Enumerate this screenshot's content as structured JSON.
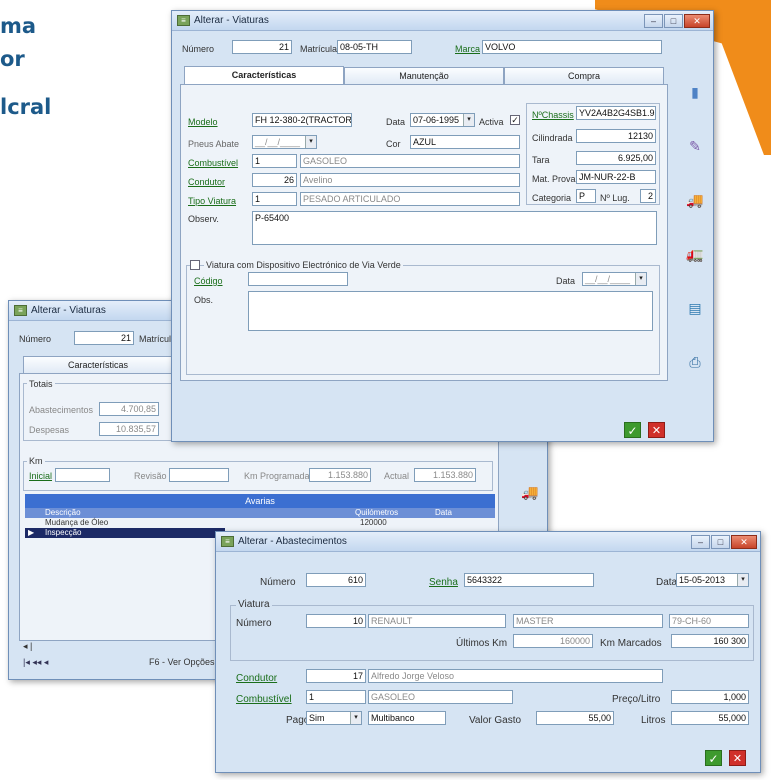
{
  "brand": {
    "line1": "ma",
    "line2": "or",
    "line3": "lcral"
  },
  "w1": {
    "title": "Alterar - Viaturas",
    "numero_label": "Número",
    "numero": "21",
    "matricula_label": "Matrícula",
    "matricula": "08-05-TH",
    "marca_label": "Marca",
    "marca": "VOLVO",
    "tabs": [
      "Características",
      "Manutenção",
      "Compra"
    ],
    "modelo_label": "Modelo",
    "modelo": "FH 12-380-2(TRACTOR)",
    "data_label": "Data",
    "data": "07-06-1995",
    "activa_label": "Activa",
    "activa_check": "✓",
    "pneus_label": "Pneus Abate",
    "pneus_val": "__/__/____",
    "cor_label": "Cor",
    "cor": "AZUL",
    "combustivel_label": "Combustível",
    "combustivel_num": "1",
    "combustivel": "GASOLEO",
    "condutor_label": "Condutor",
    "condutor_num": "26",
    "condutor": "Avelino",
    "tipo_label": "Tipo Viatura",
    "tipo_num": "1",
    "tipo": "PESADO ARTICULADO",
    "obs_label": "Observ.",
    "obs": "P-65400",
    "nchassis_label": "NºChassis",
    "nchassis": "YV2A4B2G4SB1.95",
    "cilindrada_label": "Cilindrada",
    "cilindrada": "12130",
    "tara_label": "Tara",
    "tara": "6.925,00",
    "matprova_label": "Mat. Prova",
    "matprova": "JM-NUR-22-B",
    "categoria_label": "Categoria",
    "categoria": "P",
    "nlug_label": "Nº Lug.",
    "nlug": "2",
    "disp_label": "Viatura com Dispositivo Electrónico de Via Verde",
    "codigo_label": "Código",
    "date_label": "Data",
    "date_val": "__/__/____",
    "obs2_label": "Obs."
  },
  "w2": {
    "title": "Alterar - Viaturas",
    "numero_label": "Número",
    "numero": "21",
    "matricula_label": "Matrícula",
    "tab": "Características",
    "totais_label": "Totais",
    "abast_label": "Abastecimentos",
    "abast": "4.700,85",
    "despesas_label": "Despesas",
    "despesas": "10.835,57",
    "km_label": "Km",
    "inicial_label": "Inicial",
    "revisao_label": "Revisão",
    "kmprog_label": "Km Programada",
    "kmprog": "1.153.880",
    "actual_label": "Actual",
    "actual": "1.153.880",
    "avarias_label": "Avarias",
    "col_desc": "Descrição",
    "col_kms": "Quilómetros",
    "col_data": "Data",
    "rows": [
      {
        "desc": "Mudança de Óleo",
        "kms": "120000"
      },
      {
        "desc": "Inspecção",
        "kms": ""
      }
    ],
    "status": "F6 - Ver Opções F"
  },
  "w3": {
    "title": "Alterar - Abastecimentos",
    "numero_label": "Número",
    "numero": "610",
    "senha_label": "Senha",
    "senha": "5643322",
    "data_label": "Data",
    "data": "15-05-2013",
    "viatura_label": "Viatura",
    "vnum_label": "Número",
    "vnum": "10",
    "marca": "RENAULT",
    "modelo": "MASTER",
    "matricula": "79-CH-60",
    "ultkm_label": "Últimos Km",
    "ultkm": "160000",
    "kmmarc_label": "Km Marcados",
    "kmmarc": "160 300",
    "condutor_label": "Condutor",
    "condutor_num": "17",
    "condutor": "Alfredo Jorge Veloso",
    "comb_label": "Combustível",
    "comb_num": "1",
    "comb": "GASOLEO",
    "preco_label": "Preço/Litro",
    "preco": "1,000",
    "pago_label": "Pago",
    "pago": "Sim",
    "pagamento": "Multibanco",
    "valor_label": "Valor Gasto",
    "valor": "55,00",
    "litros_label": "Litros",
    "litros": "55,000"
  }
}
